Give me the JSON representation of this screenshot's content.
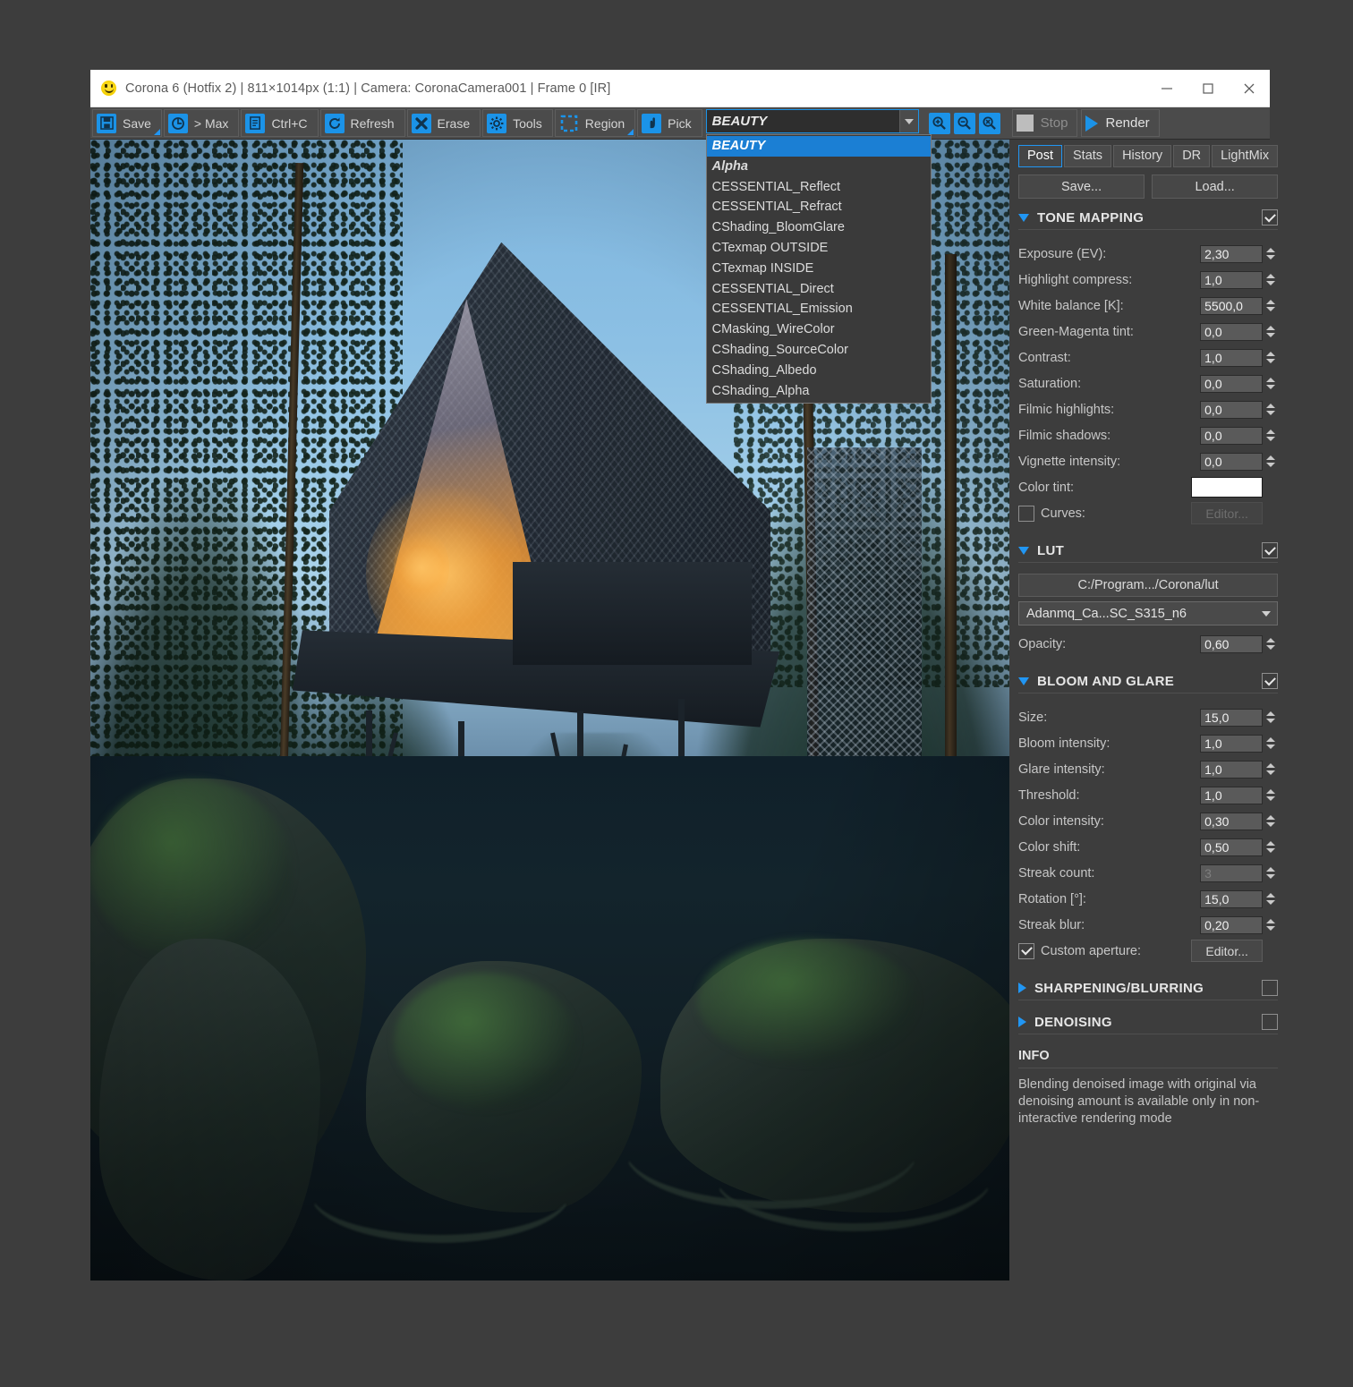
{
  "window": {
    "title": "Corona 6 (Hotfix 2) | 811×1014px (1:1) | Camera: CoronaCamera001 | Frame 0 [IR]",
    "app_icon": "smiley-icon",
    "minimize_label": "—",
    "maximize_label": "□",
    "close_label": "✕"
  },
  "toolbar": {
    "buttons": [
      {
        "label": "Save",
        "icon": "floppy-disk-icon",
        "has_arrow": true
      },
      {
        "label": "> Max",
        "icon": "max-loop-icon",
        "has_arrow": false
      },
      {
        "label": "Ctrl+C",
        "icon": "copy-icon",
        "has_arrow": false
      },
      {
        "label": "Refresh",
        "icon": "refresh-icon",
        "has_arrow": false
      },
      {
        "label": "Erase",
        "icon": "erase-x-icon",
        "has_arrow": false
      },
      {
        "label": "Tools",
        "icon": "gear-icon",
        "has_arrow": false
      },
      {
        "label": "Region",
        "icon": "region-marquee-icon",
        "has_arrow": true
      },
      {
        "label": "Pick",
        "icon": "pick-hand-icon",
        "has_arrow": false
      }
    ],
    "zoom_buttons": [
      {
        "icon": "zoom-in-icon"
      },
      {
        "icon": "zoom-out-icon"
      },
      {
        "icon": "zoom-reset-icon"
      }
    ],
    "stop_label": "Stop",
    "render_label": "Render"
  },
  "render_element": {
    "selected": "BEAUTY",
    "options": [
      {
        "label": "BEAUTY",
        "style": "italic",
        "selected": true
      },
      {
        "label": "Alpha",
        "style": "italic",
        "selected": false
      },
      {
        "label": "CESSENTIAL_Reflect",
        "style": "normal",
        "selected": false
      },
      {
        "label": "CESSENTIAL_Refract",
        "style": "normal",
        "selected": false
      },
      {
        "label": "CShading_BloomGlare",
        "style": "normal",
        "selected": false
      },
      {
        "label": "CTexmap OUTSIDE",
        "style": "normal",
        "selected": false
      },
      {
        "label": "CTexmap INSIDE",
        "style": "normal",
        "selected": false
      },
      {
        "label": "CESSENTIAL_Direct",
        "style": "normal",
        "selected": false
      },
      {
        "label": "CESSENTIAL_Emission",
        "style": "normal",
        "selected": false
      },
      {
        "label": "CMasking_WireColor",
        "style": "normal",
        "selected": false
      },
      {
        "label": "CShading_SourceColor",
        "style": "normal",
        "selected": false
      },
      {
        "label": "CShading_Albedo",
        "style": "normal",
        "selected": false
      },
      {
        "label": "CShading_Alpha",
        "style": "normal",
        "selected": false
      }
    ]
  },
  "panel": {
    "tabs": [
      {
        "label": "Post",
        "active": true
      },
      {
        "label": "Stats",
        "active": false
      },
      {
        "label": "History",
        "active": false
      },
      {
        "label": "DR",
        "active": false
      },
      {
        "label": "LightMix",
        "active": false
      }
    ],
    "save_label": "Save...",
    "load_label": "Load...",
    "tone_mapping": {
      "title": "TONE MAPPING",
      "enabled": true,
      "expanded": true,
      "rows": [
        {
          "label": "Exposure (EV):",
          "value": "2,30"
        },
        {
          "label": "Highlight compress:",
          "value": "1,0"
        },
        {
          "label": "White balance [K]:",
          "value": "5500,0"
        },
        {
          "label": "Green-Magenta tint:",
          "value": "0,0"
        },
        {
          "label": "Contrast:",
          "value": "1,0"
        },
        {
          "label": "Saturation:",
          "value": "0,0"
        },
        {
          "label": "Filmic highlights:",
          "value": "0,0"
        },
        {
          "label": "Filmic shadows:",
          "value": "0,0"
        },
        {
          "label": "Vignette intensity:",
          "value": "0,0"
        }
      ],
      "color_tint_label": "Color tint:",
      "color_tint_value": "#ffffff",
      "curves_label": "Curves:",
      "curves_checked": false,
      "curves_editor_label": "Editor..."
    },
    "lut": {
      "title": "LUT",
      "enabled": true,
      "expanded": true,
      "path": "C:/Program.../Corona/lut",
      "file": "Adanmq_Ca...SC_S315_n6",
      "opacity_label": "Opacity:",
      "opacity_value": "0,60"
    },
    "bloom_and_glare": {
      "title": "BLOOM AND GLARE",
      "enabled": true,
      "expanded": true,
      "rows": [
        {
          "label": "Size:",
          "value": "15,0",
          "dim": false
        },
        {
          "label": "Bloom intensity:",
          "value": "1,0",
          "dim": false
        },
        {
          "label": "Glare intensity:",
          "value": "1,0",
          "dim": false
        },
        {
          "label": "Threshold:",
          "value": "1,0",
          "dim": false
        },
        {
          "label": "Color intensity:",
          "value": "0,30",
          "dim": false
        },
        {
          "label": "Color shift:",
          "value": "0,50",
          "dim": false
        },
        {
          "label": "Streak count:",
          "value": "3",
          "dim": true
        },
        {
          "label": "Rotation [°]:",
          "value": "15,0",
          "dim": false
        },
        {
          "label": "Streak blur:",
          "value": "0,20",
          "dim": false
        }
      ],
      "custom_aperture_label": "Custom aperture:",
      "custom_aperture_checked": true,
      "custom_aperture_editor_label": "Editor..."
    },
    "sharpening": {
      "title": "SHARPENING/BLURRING",
      "enabled": false,
      "expanded": false
    },
    "denoising": {
      "title": "DENOISING",
      "enabled": false,
      "expanded": false
    },
    "info": {
      "title": "INFO",
      "text": "Blending denoised image with original via denoising amount is available only in non-interactive rendering mode"
    }
  },
  "viewport": {
    "name": "render-viewport",
    "description": "Rendered scene: A-frame cabin treehouse on stilts in a twilight pine forest with lit interior and mesh-clad stair tower"
  },
  "colors": {
    "accent": "#1b93e8",
    "selection": "#1b7fd4",
    "panel_bg": "#3d3d3d",
    "toolbar_bg": "#4b4b4b",
    "input_bg": "#5a5a5a",
    "titlebar_bg": "#ffffff"
  }
}
